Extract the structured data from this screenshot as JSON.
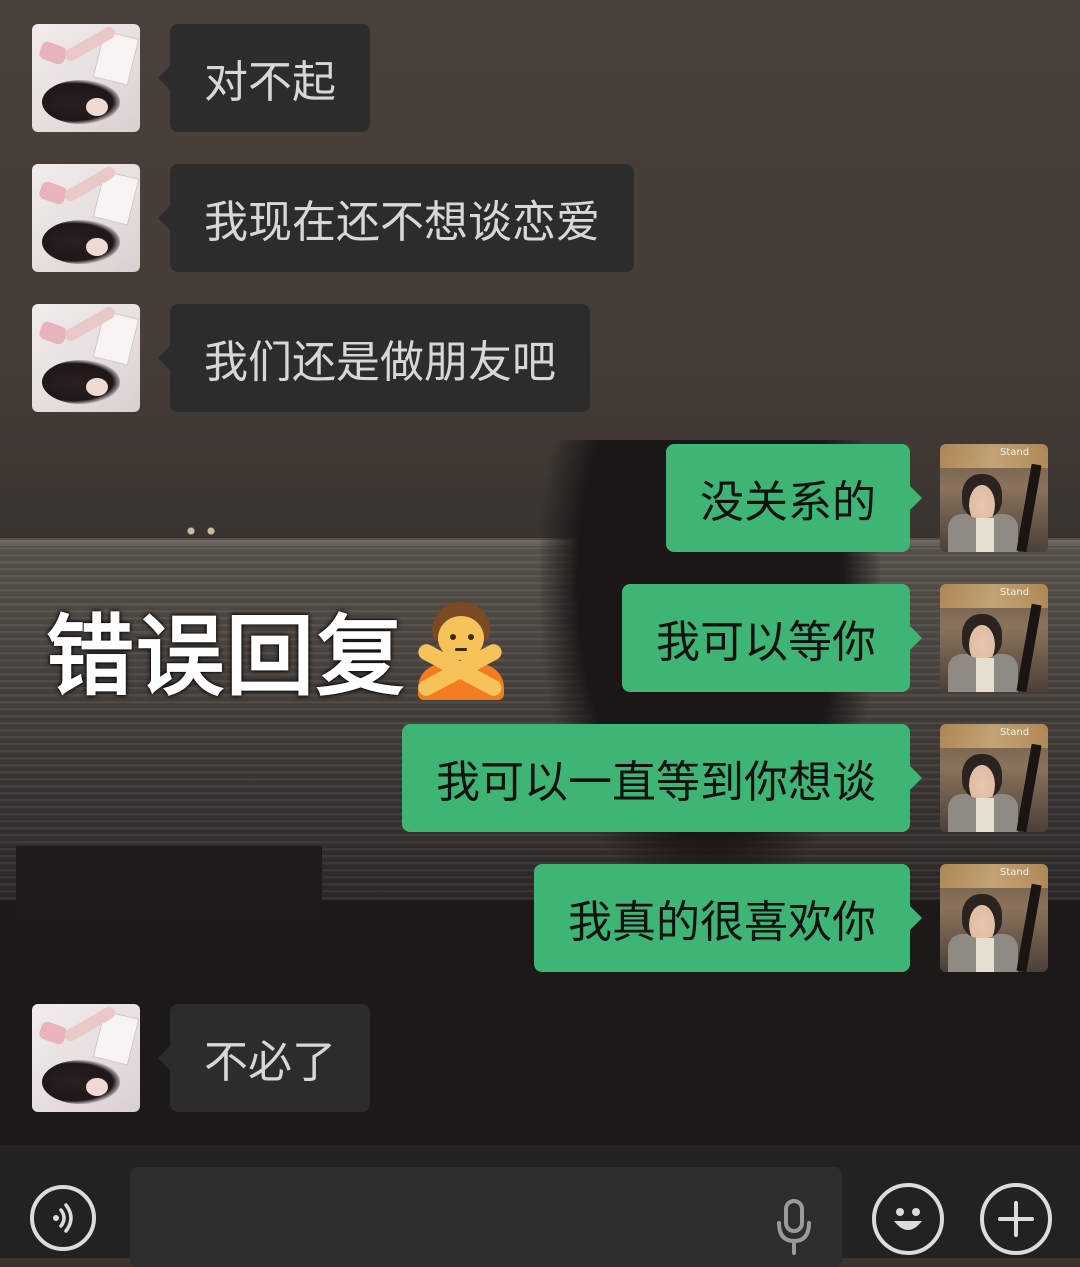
{
  "messages": [
    {
      "side": "in",
      "text": "对不起"
    },
    {
      "side": "in",
      "text": "我现在还不想谈恋爱"
    },
    {
      "side": "in",
      "text": "我们还是做朋友吧"
    },
    {
      "side": "out",
      "text": "没关系的"
    },
    {
      "side": "out",
      "text": "我可以等你"
    },
    {
      "side": "out",
      "text": "我可以一直等到你想谈"
    },
    {
      "side": "out",
      "text": "我真的很喜欢你"
    },
    {
      "side": "in",
      "text": "不必了"
    }
  ],
  "overlay": {
    "caption": "错误回复",
    "emoji": "person-gesturing-no-icon"
  },
  "avatars": {
    "boy_sign": "Stand"
  },
  "input": {
    "placeholder": ""
  },
  "colors": {
    "incoming_bubble": "#2c2c2c",
    "outgoing_bubble": "#3eb575",
    "input_bar": "#222222"
  }
}
